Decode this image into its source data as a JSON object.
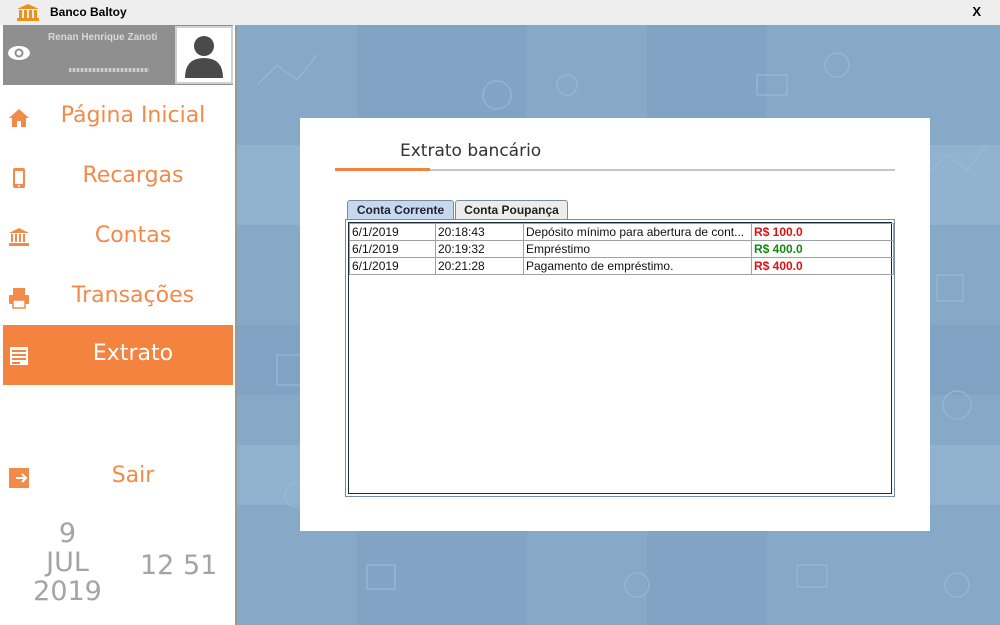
{
  "window": {
    "title": "Banco Baltoy",
    "close_label": "X"
  },
  "user": {
    "name": "Renan Henrique Zanoti"
  },
  "nav": [
    {
      "label": "Página Inicial",
      "icon": "home-icon"
    },
    {
      "label": "Recargas",
      "icon": "phone-icon"
    },
    {
      "label": "Contas",
      "icon": "bank-icon"
    },
    {
      "label": "Transações",
      "icon": "printer-icon"
    },
    {
      "label": "Extrato",
      "icon": "statement-icon",
      "active": true
    },
    {
      "label": "Sair",
      "icon": "logout-icon"
    }
  ],
  "datetime": {
    "day": "9",
    "month": "JUL",
    "year": "2019",
    "time": "12 51"
  },
  "panel": {
    "title": "Extrato bancário",
    "tabs": [
      "Conta Corrente",
      "Conta Poupança"
    ],
    "active_tab": "Conta Corrente",
    "rows": [
      {
        "date": "6/1/2019",
        "time": "20:18:43",
        "description": "Depósito mínimo para abertura de cont...",
        "amount": "R$ 100.0",
        "type": "debit"
      },
      {
        "date": "6/1/2019",
        "time": "20:19:32",
        "description": "Empréstimo",
        "amount": "R$ 400.0",
        "type": "credit"
      },
      {
        "date": "6/1/2019",
        "time": "20:21:28",
        "description": "Pagamento de empréstimo.",
        "amount": "R$ 400.0",
        "type": "debit"
      }
    ]
  },
  "colors": {
    "accent": "#f4833f",
    "debit": "#e01010",
    "credit": "#108a10",
    "background": "#86a9c8"
  }
}
